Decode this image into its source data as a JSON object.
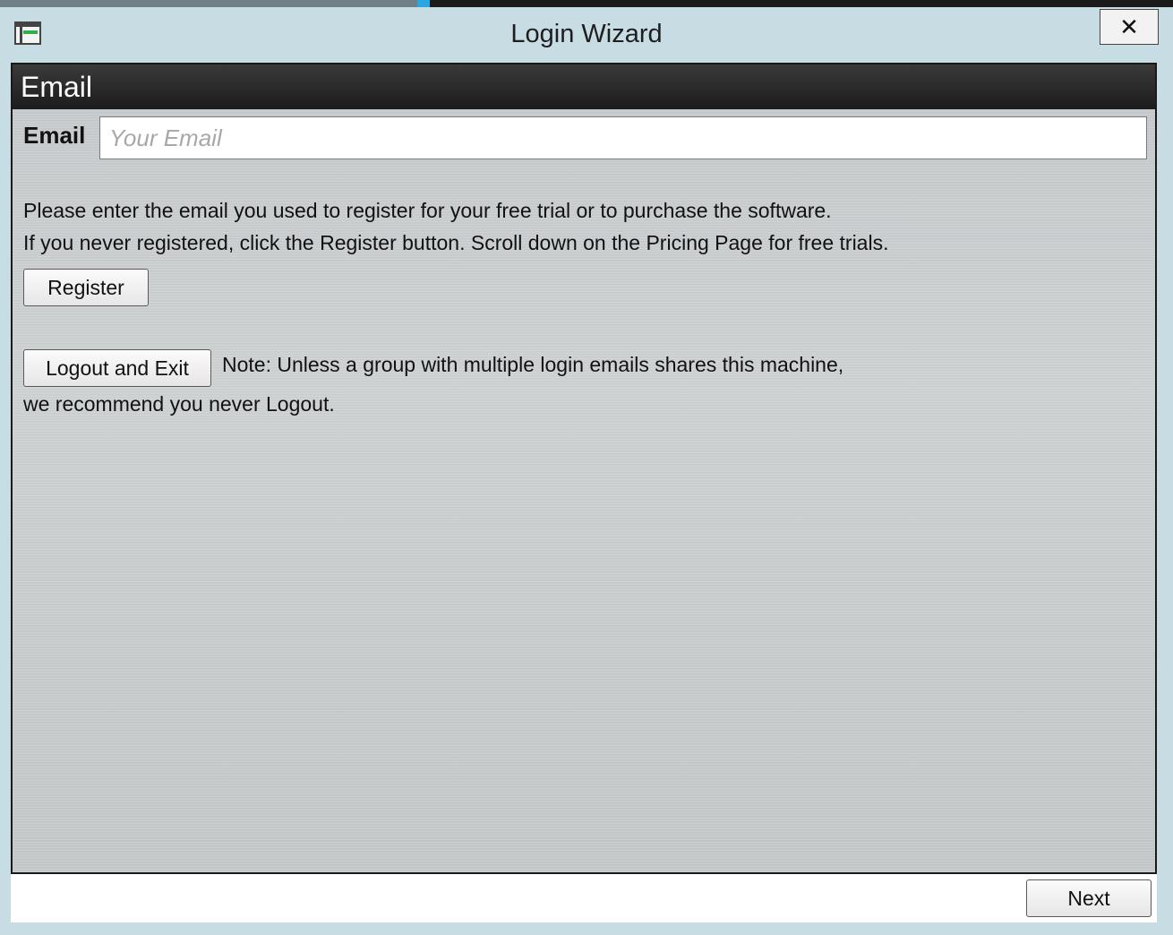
{
  "window": {
    "title": "Login Wizard",
    "close_symbol": "✕"
  },
  "section": {
    "header": "Email"
  },
  "email": {
    "label": "Email",
    "value": "",
    "placeholder": "Your Email"
  },
  "instructions": {
    "line1": "Please enter the email you used to register for your free trial or to purchase the software.",
    "line2": "If you never registered, click the Register button.  Scroll down on the Pricing Page for free trials."
  },
  "buttons": {
    "register": "Register",
    "logout": "Logout and Exit",
    "next": "Next"
  },
  "note": {
    "line1": "Note: Unless a group with multiple login emails shares this machine,",
    "line2": "we recommend you never Logout."
  },
  "icons": {
    "app": "app-window-icon",
    "close": "close-icon"
  }
}
